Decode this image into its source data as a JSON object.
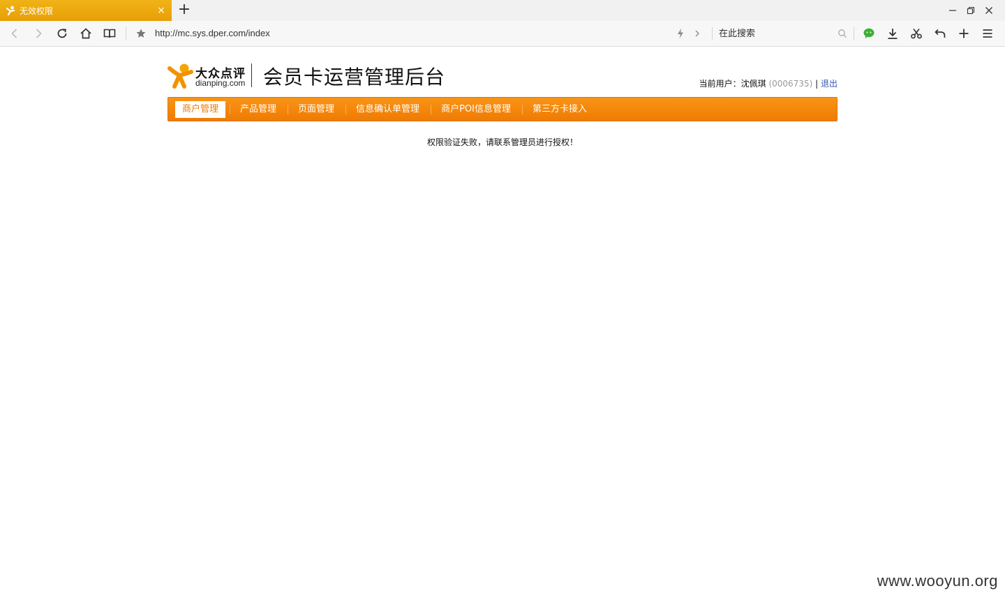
{
  "browser": {
    "tab": {
      "title": "无效权限",
      "close_glyph": "×"
    },
    "new_tab_glyph": "+",
    "window_controls": {
      "minimize": "—",
      "restore": "❐",
      "close": "✕"
    },
    "address": {
      "url": "http://mc.sys.dper.com/index"
    },
    "search": {
      "placeholder": "在此搜索"
    },
    "accent_color": "#ef9f05"
  },
  "header": {
    "logo_cn": "大众点评",
    "logo_en": "dianping.com",
    "system_title": "会员卡运营管理后台",
    "user_label": "当前用户：",
    "user_name": "沈佩琪",
    "user_id": "(0006735)",
    "separator": "|",
    "logout": "退出"
  },
  "nav": {
    "color": "#ef7b02",
    "items": [
      {
        "label": "商户管理",
        "active": true
      },
      {
        "label": "产品管理",
        "active": false
      },
      {
        "label": "页面管理",
        "active": false
      },
      {
        "label": "信息确认单管理",
        "active": false
      },
      {
        "label": "商户POI信息管理",
        "active": false
      },
      {
        "label": "第三方卡接入",
        "active": false
      }
    ]
  },
  "message": "权限验证失败，请联系管理员进行授权！",
  "watermark": "www.wooyun.org"
}
